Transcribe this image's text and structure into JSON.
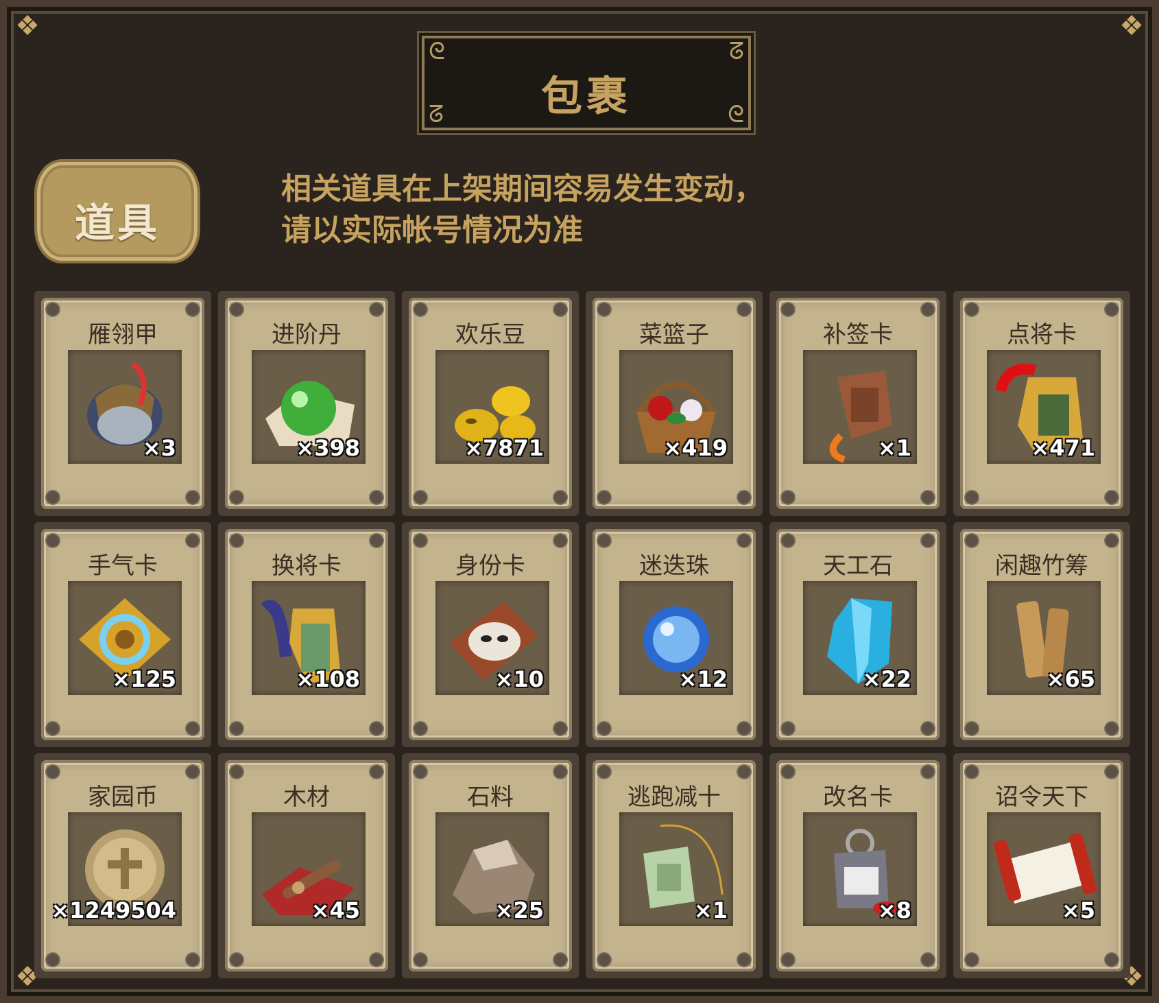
{
  "header": {
    "title": "包裹"
  },
  "tab": {
    "label": "道具"
  },
  "notice": {
    "line1": "相关道具在上架期间容易发生变动，",
    "line2": "请以实际帐号情况为准"
  },
  "items": [
    {
      "name": "雁翎甲",
      "count": "×3",
      "icon": "armor-icon"
    },
    {
      "name": "进阶丹",
      "count": "×398",
      "icon": "green-orb-icon"
    },
    {
      "name": "欢乐豆",
      "count": "×7871",
      "icon": "gold-beans-icon"
    },
    {
      "name": "菜篮子",
      "count": "×419",
      "icon": "flower-basket-icon"
    },
    {
      "name": "补签卡",
      "count": "×1",
      "icon": "bronze-tag-icon"
    },
    {
      "name": "点将卡",
      "count": "×471",
      "icon": "general-token-icon"
    },
    {
      "name": "手气卡",
      "count": "×125",
      "icon": "refresh-card-icon"
    },
    {
      "name": "换将卡",
      "count": "×108",
      "icon": "swap-token-icon"
    },
    {
      "name": "身份卡",
      "count": "×10",
      "icon": "mask-card-icon"
    },
    {
      "name": "迷迭珠",
      "count": "×12",
      "icon": "blue-orb-icon"
    },
    {
      "name": "天工石",
      "count": "×22",
      "icon": "crystal-icon"
    },
    {
      "name": "闲趣竹筹",
      "count": "×65",
      "icon": "bamboo-slips-icon"
    },
    {
      "name": "家园币",
      "count": "×1249504",
      "icon": "coin-icon"
    },
    {
      "name": "木材",
      "count": "×45",
      "icon": "wood-icon"
    },
    {
      "name": "石料",
      "count": "×25",
      "icon": "stone-icon"
    },
    {
      "name": "逃跑减十",
      "count": "×1",
      "icon": "jade-tag-icon"
    },
    {
      "name": "改名卡",
      "count": "×8",
      "icon": "name-card-icon"
    },
    {
      "name": "诏令天下",
      "count": "×5",
      "icon": "scroll-icon"
    }
  ]
}
